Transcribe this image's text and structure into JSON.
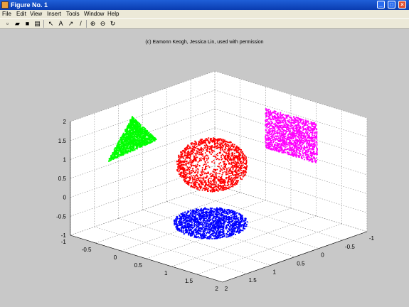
{
  "window": {
    "title": "Figure No. 1",
    "controls": {
      "minimize": "_",
      "maximize": "□",
      "close": "×"
    }
  },
  "menu": [
    "File",
    "Edit",
    "View",
    "Insert",
    "Tools",
    "Window",
    "Help"
  ],
  "toolbar": [
    {
      "name": "new-file-icon",
      "glyph": "▫"
    },
    {
      "name": "open-folder-icon",
      "glyph": "▰"
    },
    {
      "name": "save-icon",
      "glyph": "■"
    },
    {
      "name": "print-icon",
      "glyph": "▤"
    },
    {
      "name": "select-arrow-icon",
      "glyph": "↖"
    },
    {
      "name": "insert-text-icon",
      "glyph": "A"
    },
    {
      "name": "insert-arrow-icon",
      "glyph": "↗"
    },
    {
      "name": "insert-line-icon",
      "glyph": "/"
    },
    {
      "name": "zoom-in-icon",
      "glyph": "⊕"
    },
    {
      "name": "zoom-out-icon",
      "glyph": "⊖"
    },
    {
      "name": "rotate-3d-icon",
      "glyph": "↻"
    }
  ],
  "plot": {
    "title": "(c) Eamonn Keogh, Jessica Lin, used with permission"
  },
  "chart_data": {
    "type": "scatter",
    "view": "3d",
    "grid": true,
    "axes": {
      "x": {
        "range": [
          -1,
          2
        ],
        "ticks": [
          "-1",
          "-0.5",
          "0",
          "0.5",
          "1",
          "1.5",
          "2"
        ]
      },
      "y": {
        "range": [
          -1,
          2
        ],
        "ticks": [
          "-1",
          "-0.5",
          "0",
          "0.5",
          "1",
          "1.5",
          "2"
        ]
      },
      "z": {
        "range": [
          -1,
          2
        ],
        "ticks": [
          "-1",
          "-0.5",
          "0",
          "0.5",
          "1",
          "1.5",
          "2"
        ]
      }
    },
    "series": [
      {
        "shape": "sphere",
        "color": "#ff0000",
        "center": [
          0.5,
          0.5,
          0.5
        ],
        "radius": 0.45,
        "points": 1500
      },
      {
        "shape": "disc projection (z = -1)",
        "color": "#0000ff",
        "center": [
          0.5,
          0.5
        ],
        "radius": 0.45,
        "points": 1500
      },
      {
        "shape": "triangle projection",
        "color": "#00ff00",
        "points": 1500
      },
      {
        "shape": "rectangle projection",
        "color": "#ff00ff",
        "points": 1500
      }
    ]
  }
}
